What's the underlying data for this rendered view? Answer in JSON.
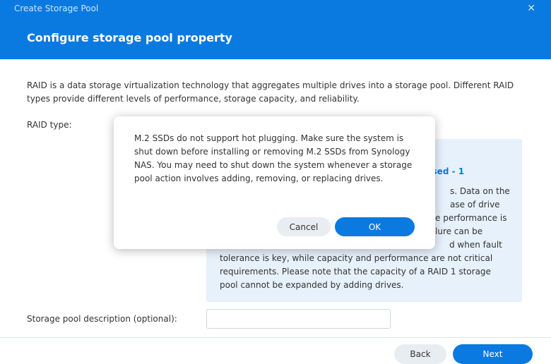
{
  "window": {
    "title": "Create Storage Pool",
    "close_glyph": "✕"
  },
  "header": {
    "title": "Configure storage pool property"
  },
  "intro": {
    "text": "RAID is a data storage virtualization technology that aggregates multiple drives into a storage pool. Different RAID types provide different levels of performance, storage capacity, and reliability."
  },
  "raid": {
    "label": "RAID type:",
    "info_title": "used - 1",
    "info_lines": [
      "s. Data on the",
      "ase of drive",
      "e performance is",
      "lure can be",
      "d when fault",
      "tolerance is key, while capacity and performance are not critical",
      "requirements. Please note that the capacity of a RAID 1 storage",
      "pool cannot be expanded by adding drives."
    ]
  },
  "description": {
    "label": "Storage pool description (optional):",
    "value": "",
    "placeholder": ""
  },
  "footer": {
    "back_label": "Back",
    "next_label": "Next"
  },
  "modal": {
    "message": "M.2 SSDs do not support hot plugging. Make sure the system is shut down before installing or removing M.2 SSDs from Synology NAS. You may need to shut down the system whenever a storage pool action involves adding, removing, or replacing drives.",
    "cancel_label": "Cancel",
    "ok_label": "OK"
  },
  "colors": {
    "accent": "#0a7ae0",
    "panel": "#e7f1fb"
  }
}
